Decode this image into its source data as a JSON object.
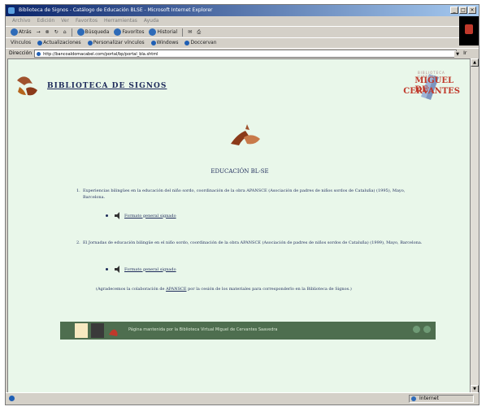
{
  "window": {
    "title": "Biblioteca de Signos - Catálogo de Educación BLSE - Microsoft Internet Explorer"
  },
  "menu": [
    "Archivo",
    "Edición",
    "Ver",
    "Favoritos",
    "Herramientas",
    "Ayuda"
  ],
  "toolbar": {
    "back": "Atrás",
    "search": "Búsqueda",
    "favorites": "Favoritos",
    "history": "Historial"
  },
  "links": {
    "label": "Vínculos",
    "items": [
      "Actualizaciones",
      "Personalizar vínculos",
      "Windows",
      "Doccervan"
    ]
  },
  "address": {
    "label": "Dirección",
    "url": "http://bancoaldomacabel.com/portal/bp/portal_bla.shtml",
    "go": "Ir"
  },
  "page": {
    "library_title": "BIBLIOTECA DE SIGNOS",
    "brand_small": "BIBLIOTECA VIRTUAL",
    "brand_top": "MIGUEL DE",
    "brand_bottom": "CERVANTES",
    "section_title": "EDUCACIÓN BL-SE",
    "items": [
      {
        "num": "1.",
        "text": "Experiencias bilingües en la educación del niño sordo, coordinación de la obra APANSCE (Asociación de padres de niños sordos de Cataluña) (1995), Mayo, Barcelona.",
        "link": "Formato general signado"
      },
      {
        "num": "2.",
        "text": "El Jornadas de educación bilingüe en el niño sordo, coordinación de la obra APANSCE (Asociación de padres de niños sordos de Cataluña) (1999), Mayo, Barcelona.",
        "link": "Formato general signado"
      }
    ],
    "thanks_pre": "(Agradecemos la colaboración de ",
    "thanks_link": "APANSCE",
    "thanks_post": " por la cesión de los materiales para corresponderlo en la Biblioteca de Signos.)",
    "footer_text": "Página mantenida por la Biblioteca Virtual Miguel de Cervantes Saavedra"
  },
  "status": {
    "zone": "Internet"
  }
}
